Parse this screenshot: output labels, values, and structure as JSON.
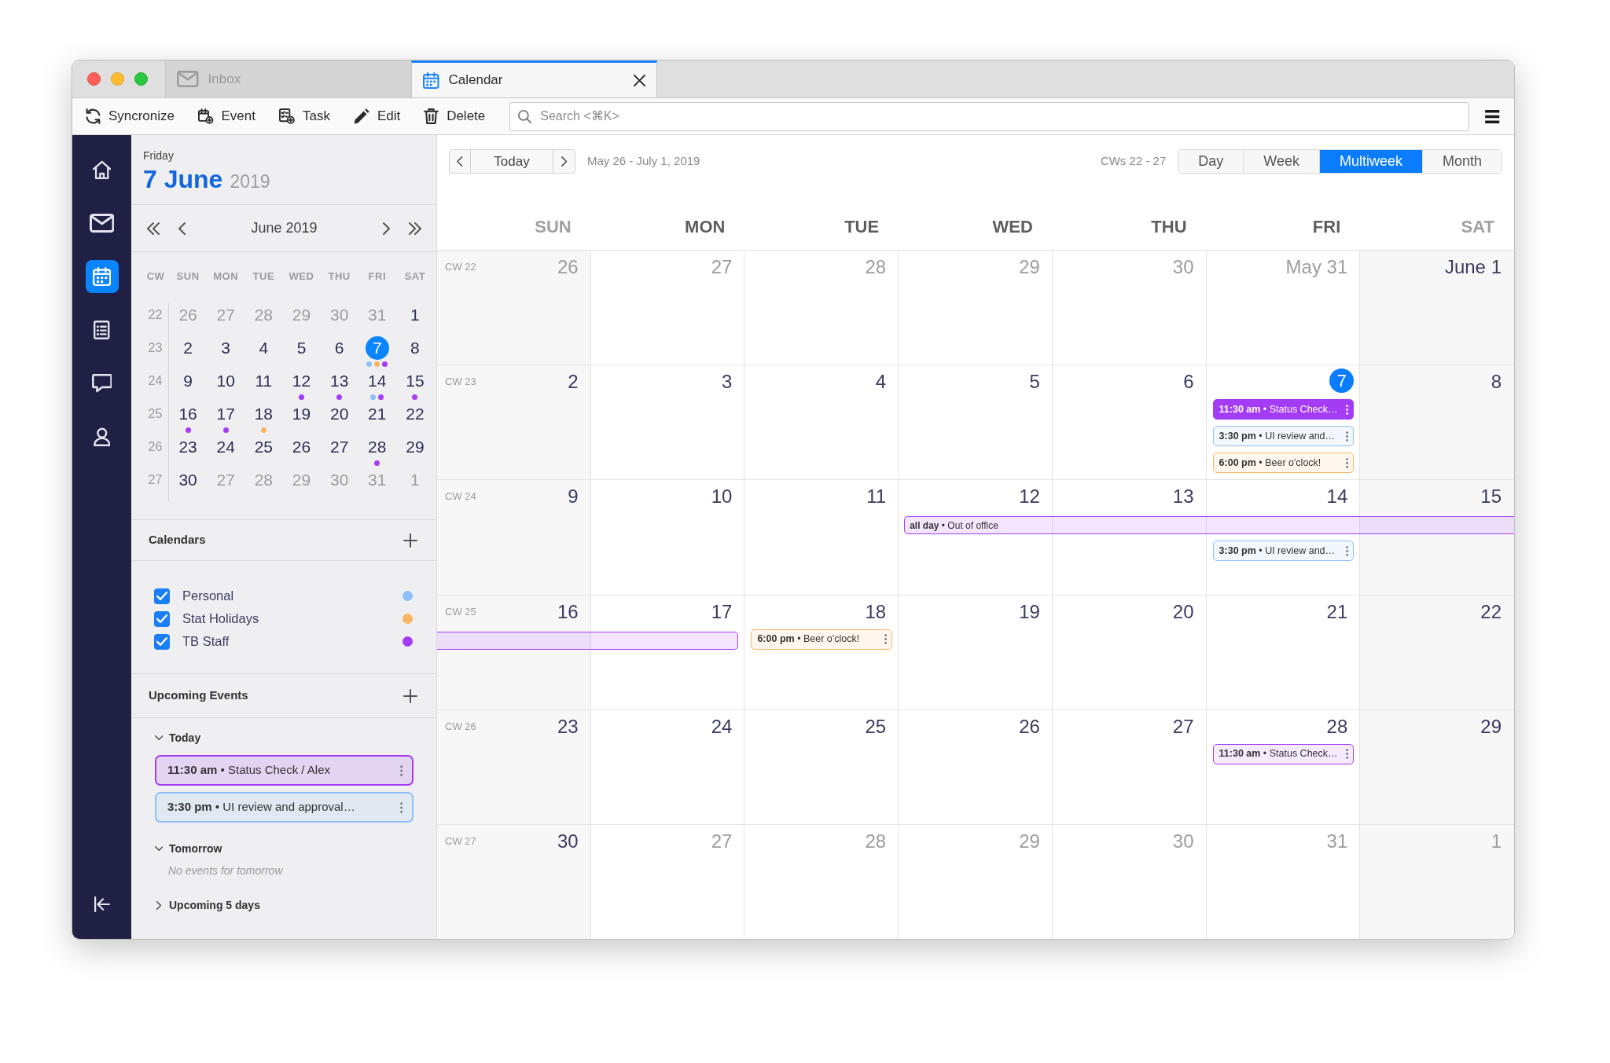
{
  "tabs": [
    {
      "kind": "mail",
      "label": "Inbox",
      "selected": false
    },
    {
      "kind": "calendar",
      "label": "Calendar",
      "selected": true
    }
  ],
  "toolbar": {
    "buttons": [
      {
        "kind": "sync",
        "label": "Syncronize"
      },
      {
        "kind": "event",
        "label": "Event"
      },
      {
        "kind": "task",
        "label": "Task"
      },
      {
        "kind": "edit",
        "label": "Edit"
      },
      {
        "kind": "delete",
        "label": "Delete"
      }
    ],
    "search": {
      "placeholder": "Search <⌘K>"
    }
  },
  "nav_rail": {
    "items": [
      {
        "kind": "home",
        "selected": false
      },
      {
        "kind": "mail",
        "selected": false
      },
      {
        "kind": "calendar",
        "selected": true
      },
      {
        "kind": "tasks",
        "selected": false
      },
      {
        "kind": "chat",
        "selected": false
      },
      {
        "kind": "contacts",
        "selected": false
      }
    ]
  },
  "side_panel": {
    "weekday": "Friday",
    "date": "7 June",
    "year": "2019",
    "mini_calendar": {
      "month": "June 2019",
      "columns": [
        "CW",
        "SUN",
        "MON",
        "TUE",
        "WED",
        "THU",
        "FRI",
        "SAT"
      ],
      "weeks": [
        {
          "cw": "22",
          "days": [
            {
              "label": "26",
              "outside": true,
              "selected": false
            },
            {
              "label": "27",
              "outside": true,
              "selected": false
            },
            {
              "label": "28",
              "outside": true,
              "selected": false
            },
            {
              "label": "29",
              "outside": true,
              "selected": false
            },
            {
              "label": "30",
              "outside": true,
              "selected": false
            },
            {
              "label": "31",
              "outside": true,
              "selected": false
            },
            {
              "label": "1",
              "outside": false,
              "selected": false
            }
          ]
        },
        {
          "cw": "23",
          "days": [
            {
              "label": "2",
              "outside": false,
              "selected": false
            },
            {
              "label": "3",
              "outside": false,
              "selected": false
            },
            {
              "label": "4",
              "outside": false,
              "selected": false
            },
            {
              "label": "5",
              "outside": false,
              "selected": false
            },
            {
              "label": "6",
              "outside": false,
              "selected": false
            },
            {
              "label": "7",
              "outside": false,
              "selected": true,
              "dots": [
                {
                  "color": "#8cc0fa"
                },
                {
                  "color": "#fbb561"
                },
                {
                  "color": "#a43cf5"
                }
              ]
            },
            {
              "label": "8",
              "outside": false,
              "selected": false
            }
          ]
        },
        {
          "cw": "24",
          "days": [
            {
              "label": "9",
              "outside": false,
              "selected": false
            },
            {
              "label": "10",
              "outside": false,
              "selected": false
            },
            {
              "label": "11",
              "outside": false,
              "selected": false
            },
            {
              "label": "12",
              "outside": false,
              "selected": false,
              "dots": [
                {
                  "color": "#a43cf5"
                }
              ]
            },
            {
              "label": "13",
              "outside": false,
              "selected": false,
              "dots": [
                {
                  "color": "#a43cf5"
                }
              ]
            },
            {
              "label": "14",
              "outside": false,
              "selected": false,
              "dots": [
                {
                  "color": "#8cc0fa"
                },
                {
                  "color": "#a43cf5"
                }
              ]
            },
            {
              "label": "15",
              "outside": false,
              "selected": false,
              "dots": [
                {
                  "color": "#a43cf5"
                }
              ]
            }
          ]
        },
        {
          "cw": "25",
          "days": [
            {
              "label": "16",
              "outside": false,
              "selected": false,
              "dots": [
                {
                  "color": "#a43cf5"
                }
              ]
            },
            {
              "label": "17",
              "outside": false,
              "selected": false,
              "dots": [
                {
                  "color": "#a43cf5"
                }
              ]
            },
            {
              "label": "18",
              "outside": false,
              "selected": false,
              "dots": [
                {
                  "color": "#fbb561"
                }
              ]
            },
            {
              "label": "19",
              "outside": false,
              "selected": false
            },
            {
              "label": "20",
              "outside": false,
              "selected": false
            },
            {
              "label": "21",
              "outside": false,
              "selected": false
            },
            {
              "label": "22",
              "outside": false,
              "selected": false
            }
          ]
        },
        {
          "cw": "26",
          "days": [
            {
              "label": "23",
              "outside": false,
              "selected": false
            },
            {
              "label": "24",
              "outside": false,
              "selected": false
            },
            {
              "label": "25",
              "outside": false,
              "selected": false
            },
            {
              "label": "26",
              "outside": false,
              "selected": false
            },
            {
              "label": "27",
              "outside": false,
              "selected": false
            },
            {
              "label": "28",
              "outside": false,
              "selected": false,
              "dots": [
                {
                  "color": "#a43cf5"
                }
              ]
            },
            {
              "label": "29",
              "outside": false,
              "selected": false
            }
          ]
        },
        {
          "cw": "27",
          "days": [
            {
              "label": "30",
              "outside": false,
              "selected": false
            },
            {
              "label": "27",
              "outside": true,
              "selected": false
            },
            {
              "label": "28",
              "outside": true,
              "selected": false
            },
            {
              "label": "29",
              "outside": true,
              "selected": false
            },
            {
              "label": "30",
              "outside": true,
              "selected": false
            },
            {
              "label": "31",
              "outside": true,
              "selected": false
            },
            {
              "label": "1",
              "outside": true,
              "selected": false
            }
          ]
        }
      ]
    },
    "calendars": {
      "title": "Calendars",
      "items": [
        {
          "label": "Personal",
          "checked": true,
          "color": "#8cc0fa"
        },
        {
          "label": "Stat Holidays",
          "checked": true,
          "color": "#fbb561"
        },
        {
          "label": "TB Staff",
          "checked": true,
          "color": "#a43cf5"
        }
      ]
    },
    "upcoming": {
      "title": "Upcoming Events",
      "groups": [
        {
          "label": "Today",
          "expanded": true,
          "events": [
            {
              "text": "**11:30 am** • Status Check / Alex",
              "color": "#a43cf5"
            },
            {
              "text": "**3:30 pm** • UI review and approval…",
              "color": "#8cc0fa"
            }
          ]
        },
        {
          "label": "Tomorrow",
          "expanded": true,
          "empty_note": "No events for tomorrow"
        },
        {
          "label": "Upcoming 5 days",
          "expanded": false
        }
      ]
    }
  },
  "main": {
    "today_button": "Today",
    "range": "May 26 - July 1, 2019",
    "cw_range": "CWs 22 - 27",
    "views": [
      {
        "label": "Day",
        "selected": false
      },
      {
        "label": "Week",
        "selected": false
      },
      {
        "label": "Multiweek",
        "selected": true
      },
      {
        "label": "Month",
        "selected": false
      }
    ],
    "weekdays": [
      {
        "label": "SUN",
        "weekend": true
      },
      {
        "label": "MON",
        "weekend": false
      },
      {
        "label": "TUE",
        "weekend": false
      },
      {
        "label": "WED",
        "weekend": false
      },
      {
        "label": "THU",
        "weekend": false
      },
      {
        "label": "FRI",
        "weekend": false
      },
      {
        "label": "SAT",
        "weekend": true
      }
    ],
    "weeks": [
      {
        "cw": "CW 22",
        "days": [
          {
            "label": "26",
            "outside": true,
            "today": false
          },
          {
            "label": "27",
            "outside": true,
            "today": false
          },
          {
            "label": "28",
            "outside": true,
            "today": false
          },
          {
            "label": "29",
            "outside": true,
            "today": false
          },
          {
            "label": "30",
            "outside": true,
            "today": false
          },
          {
            "label": "May 31",
            "outside": true,
            "today": false
          },
          {
            "label": "June 1",
            "outside": false,
            "today": false
          }
        ]
      },
      {
        "cw": "CW 23",
        "days": [
          {
            "label": "2",
            "outside": false,
            "today": false
          },
          {
            "label": "3",
            "outside": false,
            "today": false
          },
          {
            "label": "4",
            "outside": false,
            "today": false
          },
          {
            "label": "5",
            "outside": false,
            "today": false
          },
          {
            "label": "6",
            "outside": false,
            "today": false
          },
          {
            "label": "7",
            "outside": false,
            "today": true,
            "events": [
              {
                "text": "**11:30 am** • Status Check…",
                "color": "#a43cf5",
                "selected": true
              },
              {
                "text": "**3:30 pm** • UI review and…",
                "color": "#8cc0fa",
                "selected": false
              },
              {
                "text": "**6:00 pm** • Beer o'clock!",
                "color": "#fbb561",
                "selected": false
              }
            ]
          },
          {
            "label": "8",
            "outside": false,
            "today": false
          }
        ]
      },
      {
        "cw": "CW 24",
        "all_day_event": {
          "text": "**all day** • Out of office",
          "color": "#a43cf5",
          "covers": [
            false,
            false,
            false,
            true,
            true,
            true,
            true
          ]
        },
        "days": [
          {
            "label": "9",
            "outside": false,
            "today": false
          },
          {
            "label": "10",
            "outside": false,
            "today": false
          },
          {
            "label": "11",
            "outside": false,
            "today": false
          },
          {
            "label": "12",
            "outside": false,
            "today": false
          },
          {
            "label": "13",
            "outside": false,
            "today": false
          },
          {
            "label": "14",
            "outside": false,
            "today": false,
            "events": [
              {
                "text": "**3:30 pm** • UI review and…",
                "color": "#8cc0fa",
                "selected": false
              }
            ]
          },
          {
            "label": "15",
            "outside": false,
            "today": false
          }
        ]
      },
      {
        "cw": "CW 25",
        "all_day_event": {
          "color": "#a43cf5",
          "covers": [
            true,
            true,
            false,
            false,
            false,
            false,
            false
          ]
        },
        "days": [
          {
            "label": "16",
            "outside": false,
            "today": false
          },
          {
            "label": "17",
            "outside": false,
            "today": false
          },
          {
            "label": "18",
            "outside": false,
            "today": false,
            "events": [
              {
                "text": "**6:00 pm** • Beer o'clock!",
                "color": "#fbb561",
                "selected": false
              }
            ]
          },
          {
            "label": "19",
            "outside": false,
            "today": false
          },
          {
            "label": "20",
            "outside": false,
            "today": false
          },
          {
            "label": "21",
            "outside": false,
            "today": false
          },
          {
            "label": "22",
            "outside": false,
            "today": false
          }
        ]
      },
      {
        "cw": "CW 26",
        "days": [
          {
            "label": "23",
            "outside": false,
            "today": false
          },
          {
            "label": "24",
            "outside": false,
            "today": false
          },
          {
            "label": "25",
            "outside": false,
            "today": false
          },
          {
            "label": "26",
            "outside": false,
            "today": false
          },
          {
            "label": "27",
            "outside": false,
            "today": false
          },
          {
            "label": "28",
            "outside": false,
            "today": false,
            "events": [
              {
                "text": "**11:30 am** • Status Check…",
                "color": "#a43cf5",
                "selected": false
              }
            ]
          },
          {
            "label": "29",
            "outside": false,
            "today": false
          }
        ]
      },
      {
        "cw": "CW 27",
        "days": [
          {
            "label": "30",
            "outside": false,
            "today": false
          },
          {
            "label": "27",
            "outside": true,
            "today": false
          },
          {
            "label": "28",
            "outside": true,
            "today": false
          },
          {
            "label": "29",
            "outside": true,
            "today": false
          },
          {
            "label": "30",
            "outside": true,
            "today": false
          },
          {
            "label": "31",
            "outside": true,
            "today": false
          },
          {
            "label": "1",
            "outside": true,
            "today": false
          }
        ]
      }
    ]
  }
}
